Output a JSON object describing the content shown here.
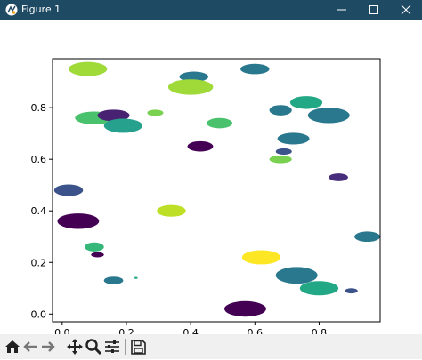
{
  "window": {
    "title": "Figure 1",
    "titlebar_color": "#1f4a63",
    "controls": [
      "minimize-icon",
      "maximize-icon",
      "close-icon"
    ]
  },
  "toolbar": {
    "icons": [
      "home-icon",
      "back-icon",
      "forward-icon",
      "pan-icon",
      "zoom-icon",
      "configure-subplots-icon",
      "save-icon"
    ]
  },
  "chart_data": {
    "type": "scatter",
    "title": "",
    "xlabel": "",
    "ylabel": "",
    "xlim": [
      -0.03,
      0.99
    ],
    "ylim": [
      -0.03,
      0.99
    ],
    "xticks": [
      "0.0",
      "0.2",
      "0.4",
      "0.6",
      "0.8"
    ],
    "yticks": [
      "0.0",
      "0.2",
      "0.4",
      "0.6",
      "0.8"
    ],
    "grid": false,
    "ellipses": [
      {
        "x": 0.08,
        "y": 0.95,
        "w": 0.12,
        "h": 0.055,
        "color": "#a0da39"
      },
      {
        "x": 0.41,
        "y": 0.92,
        "w": 0.09,
        "h": 0.04,
        "color": "#2a788e"
      },
      {
        "x": 0.4,
        "y": 0.88,
        "w": 0.14,
        "h": 0.06,
        "color": "#a0da39"
      },
      {
        "x": 0.6,
        "y": 0.95,
        "w": 0.09,
        "h": 0.04,
        "color": "#2a788e"
      },
      {
        "x": 0.1,
        "y": 0.76,
        "w": 0.12,
        "h": 0.05,
        "color": "#4ac16d"
      },
      {
        "x": 0.16,
        "y": 0.77,
        "w": 0.1,
        "h": 0.045,
        "color": "#482173"
      },
      {
        "x": 0.19,
        "y": 0.73,
        "w": 0.12,
        "h": 0.055,
        "color": "#25a18e"
      },
      {
        "x": 0.29,
        "y": 0.78,
        "w": 0.05,
        "h": 0.025,
        "color": "#7ad151"
      },
      {
        "x": 0.49,
        "y": 0.74,
        "w": 0.08,
        "h": 0.04,
        "color": "#4ac16d"
      },
      {
        "x": 0.43,
        "y": 0.65,
        "w": 0.08,
        "h": 0.04,
        "color": "#440154"
      },
      {
        "x": 0.68,
        "y": 0.79,
        "w": 0.07,
        "h": 0.04,
        "color": "#2a788e"
      },
      {
        "x": 0.76,
        "y": 0.82,
        "w": 0.1,
        "h": 0.05,
        "color": "#22a884"
      },
      {
        "x": 0.83,
        "y": 0.77,
        "w": 0.13,
        "h": 0.06,
        "color": "#2a788e"
      },
      {
        "x": 0.72,
        "y": 0.68,
        "w": 0.1,
        "h": 0.045,
        "color": "#2a788e"
      },
      {
        "x": 0.69,
        "y": 0.63,
        "w": 0.05,
        "h": 0.025,
        "color": "#3b528b"
      },
      {
        "x": 0.68,
        "y": 0.6,
        "w": 0.07,
        "h": 0.03,
        "color": "#7ad151"
      },
      {
        "x": 0.86,
        "y": 0.53,
        "w": 0.06,
        "h": 0.03,
        "color": "#472d7b"
      },
      {
        "x": 0.02,
        "y": 0.48,
        "w": 0.09,
        "h": 0.045,
        "color": "#3b528b"
      },
      {
        "x": 0.05,
        "y": 0.36,
        "w": 0.13,
        "h": 0.06,
        "color": "#440154"
      },
      {
        "x": 0.34,
        "y": 0.4,
        "w": 0.09,
        "h": 0.045,
        "color": "#bddf26"
      },
      {
        "x": 0.1,
        "y": 0.26,
        "w": 0.06,
        "h": 0.035,
        "color": "#35b779"
      },
      {
        "x": 0.11,
        "y": 0.23,
        "w": 0.04,
        "h": 0.02,
        "color": "#440154"
      },
      {
        "x": 0.95,
        "y": 0.3,
        "w": 0.08,
        "h": 0.04,
        "color": "#2a788e"
      },
      {
        "x": 0.62,
        "y": 0.22,
        "w": 0.12,
        "h": 0.055,
        "color": "#fde725"
      },
      {
        "x": 0.73,
        "y": 0.15,
        "w": 0.13,
        "h": 0.065,
        "color": "#2a788e"
      },
      {
        "x": 0.8,
        "y": 0.1,
        "w": 0.12,
        "h": 0.055,
        "color": "#22a884"
      },
      {
        "x": 0.9,
        "y": 0.09,
        "w": 0.04,
        "h": 0.02,
        "color": "#3b528b"
      },
      {
        "x": 0.16,
        "y": 0.13,
        "w": 0.06,
        "h": 0.03,
        "color": "#2a788e"
      },
      {
        "x": 0.23,
        "y": 0.14,
        "w": 0.01,
        "h": 0.008,
        "color": "#22a884"
      },
      {
        "x": 0.57,
        "y": 0.02,
        "w": 0.13,
        "h": 0.06,
        "color": "#440154"
      }
    ]
  }
}
